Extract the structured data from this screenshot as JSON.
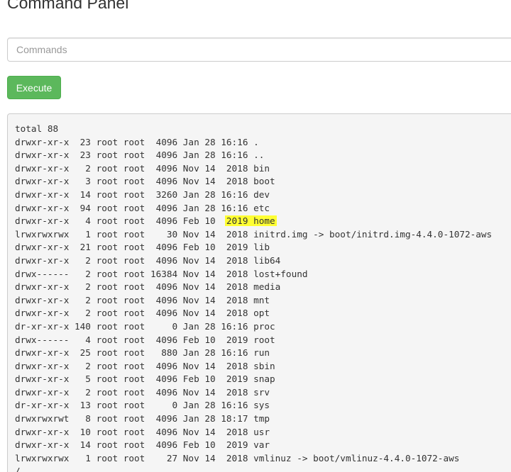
{
  "title": "Command Panel",
  "command_input": {
    "placeholder": "Commands",
    "value": ""
  },
  "execute_button": {
    "label": "Execute",
    "color": "#5cb85c"
  },
  "output": {
    "highlight_color": "#ffff33",
    "lines": [
      {
        "pre": "total 88",
        "hl": "",
        "post": ""
      },
      {
        "pre": "drwxr-xr-x  23 root root  4096 Jan 28 16:16 .",
        "hl": "",
        "post": ""
      },
      {
        "pre": "drwxr-xr-x  23 root root  4096 Jan 28 16:16 ..",
        "hl": "",
        "post": ""
      },
      {
        "pre": "drwxr-xr-x   2 root root  4096 Nov 14  2018 bin",
        "hl": "",
        "post": ""
      },
      {
        "pre": "drwxr-xr-x   3 root root  4096 Nov 14  2018 boot",
        "hl": "",
        "post": ""
      },
      {
        "pre": "drwxr-xr-x  14 root root  3260 Jan 28 16:16 dev",
        "hl": "",
        "post": ""
      },
      {
        "pre": "drwxr-xr-x  94 root root  4096 Jan 28 16:16 etc",
        "hl": "",
        "post": ""
      },
      {
        "pre": "drwxr-xr-x   4 root root  4096 Feb 10  ",
        "hl": "2019 home",
        "post": ""
      },
      {
        "pre": "lrwxrwxrwx   1 root root    30 Nov 14  2018 initrd.img -> boot/initrd.img-4.4.0-1072-aws",
        "hl": "",
        "post": ""
      },
      {
        "pre": "drwxr-xr-x  21 root root  4096 Feb 10  2019 lib",
        "hl": "",
        "post": ""
      },
      {
        "pre": "drwxr-xr-x   2 root root  4096 Nov 14  2018 lib64",
        "hl": "",
        "post": ""
      },
      {
        "pre": "drwx------   2 root root 16384 Nov 14  2018 lost+found",
        "hl": "",
        "post": ""
      },
      {
        "pre": "drwxr-xr-x   2 root root  4096 Nov 14  2018 media",
        "hl": "",
        "post": ""
      },
      {
        "pre": "drwxr-xr-x   2 root root  4096 Nov 14  2018 mnt",
        "hl": "",
        "post": ""
      },
      {
        "pre": "drwxr-xr-x   2 root root  4096 Nov 14  2018 opt",
        "hl": "",
        "post": ""
      },
      {
        "pre": "dr-xr-xr-x 140 root root     0 Jan 28 16:16 proc",
        "hl": "",
        "post": ""
      },
      {
        "pre": "drwx------   4 root root  4096 Feb 10  2019 root",
        "hl": "",
        "post": ""
      },
      {
        "pre": "drwxr-xr-x  25 root root   880 Jan 28 16:16 run",
        "hl": "",
        "post": ""
      },
      {
        "pre": "drwxr-xr-x   2 root root  4096 Nov 14  2018 sbin",
        "hl": "",
        "post": ""
      },
      {
        "pre": "drwxr-xr-x   5 root root  4096 Feb 10  2019 snap",
        "hl": "",
        "post": ""
      },
      {
        "pre": "drwxr-xr-x   2 root root  4096 Nov 14  2018 srv",
        "hl": "",
        "post": ""
      },
      {
        "pre": "dr-xr-xr-x  13 root root     0 Jan 28 16:16 sys",
        "hl": "",
        "post": ""
      },
      {
        "pre": "drwxrwxrwt   8 root root  4096 Jan 28 18:17 tmp",
        "hl": "",
        "post": ""
      },
      {
        "pre": "drwxr-xr-x  10 root root  4096 Nov 14  2018 usr",
        "hl": "",
        "post": ""
      },
      {
        "pre": "drwxr-xr-x  14 root root  4096 Feb 10  2019 var",
        "hl": "",
        "post": ""
      },
      {
        "pre": "lrwxrwxrwx   1 root root    27 Nov 14  2018 vmlinuz -> boot/vmlinuz-4.4.0-1072-aws",
        "hl": "",
        "post": ""
      },
      {
        "pre": "/",
        "hl": "",
        "post": ""
      }
    ]
  }
}
